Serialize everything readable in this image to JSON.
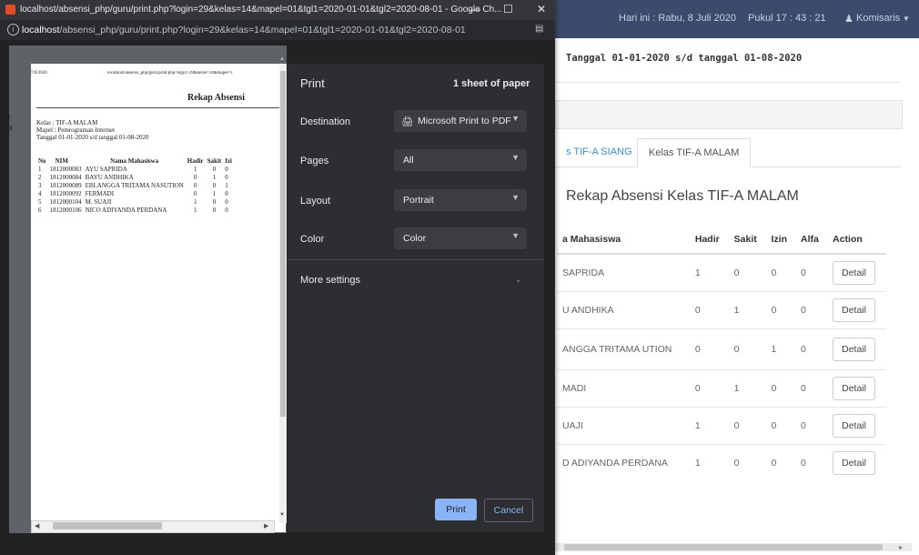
{
  "app": {
    "topbar": {
      "date_text": "Hari ini : Rabu, 8 Juli 2020",
      "time_text": "Pukul 17 : 43 : 21",
      "user": "Komisaris"
    },
    "subtitle": "Tanggal 01-01-2020 s/d tanggal 01-08-2020",
    "tabs": [
      "s TIF-A SIANG",
      "Kelas TIF-A MALAM"
    ],
    "heading": "Rekap Absensi Kelas TIF-A MALAM",
    "table": {
      "headers": [
        "a Mahasiswa",
        "Hadir",
        "Sakit",
        "Izin",
        "Alfa",
        "Action"
      ],
      "rows": [
        {
          "name": "SAPRIDA",
          "hadir": "1",
          "sakit": "0",
          "izin": "0",
          "alfa": "0",
          "action": "Detail"
        },
        {
          "name": "U ANDHIKA",
          "hadir": "0",
          "sakit": "1",
          "izin": "0",
          "alfa": "0",
          "action": "Detail"
        },
        {
          "name": "ANGGA TRITAMA UTION",
          "hadir": "0",
          "sakit": "0",
          "izin": "1",
          "alfa": "0",
          "action": "Detail"
        },
        {
          "name": "MADI",
          "hadir": "0",
          "sakit": "1",
          "izin": "0",
          "alfa": "0",
          "action": "Detail"
        },
        {
          "name": "UAJI",
          "hadir": "1",
          "sakit": "0",
          "izin": "0",
          "alfa": "0",
          "action": "Detail"
        },
        {
          "name": "D ADIYANDA PERDANA",
          "hadir": "1",
          "sakit": "0",
          "izin": "0",
          "alfa": "0",
          "action": "Detail"
        }
      ]
    }
  },
  "popup": {
    "window_title": "localhost/absensi_php/guru/print.php?login=29&kelas=14&mapel=01&tgl1=2020-01-01&tgl2=2020-08-01 - Google Ch...",
    "url_host": "localhost",
    "url_path": "/absensi_php/guru/print.php?login=29&kelas=14&mapel=01&tgl1=2020-01-01&tgl2=2020-08-01",
    "buttons": {
      "minimize": "—",
      "maximize": "☐",
      "close": "✕"
    }
  },
  "preview": {
    "page_date": "7/8/2020",
    "page_url": "localhost/absensi_php/guru/print.php?login=29&kelas=14&mapel=1",
    "title": "Rekap Absensi",
    "kelas": "Kelas : TIF-A MALAM",
    "mapel": "Mapel : Pemrograman Internet",
    "tanggal": "Tanggal 01-01-2020 s/d tanggal 01-08-2020",
    "headers": [
      "No",
      "NIM",
      "Nama Mahasiswa",
      "Hadir",
      "Sakit",
      "Izi"
    ],
    "rows": [
      [
        "1",
        "1812000083",
        "AYU SAPRIDA",
        "1",
        "0",
        "0"
      ],
      [
        "2",
        "1812000084",
        "BAYU ANDHIKA",
        "0",
        "1",
        "0"
      ],
      [
        "3",
        "1812000089",
        "ERLANGGA TRITAMA NASUTION",
        "0",
        "0",
        "1"
      ],
      [
        "4",
        "1812000092",
        "FERMADI",
        "0",
        "1",
        "0"
      ],
      [
        "5",
        "1812000104",
        "M. SUAJI",
        "1",
        "0",
        "0"
      ],
      [
        "6",
        "1812000106",
        "NICO ADIYANDA PERDANA",
        "1",
        "0",
        "0"
      ]
    ],
    "bg_edge_letters": [
      "Ke",
      "Ma",
      "Ta",
      "N",
      "1",
      "2",
      "3",
      "4",
      "5",
      "6"
    ]
  },
  "print_dialog": {
    "title": "Print",
    "sheets": "1 sheet of paper",
    "destination_label": "Destination",
    "destination_value": "Microsoft Print to PDF",
    "pages_label": "Pages",
    "pages_value": "All",
    "layout_label": "Layout",
    "layout_value": "Portrait",
    "color_label": "Color",
    "color_value": "Color",
    "more_settings": "More settings",
    "print_button": "Print",
    "cancel_button": "Cancel"
  }
}
